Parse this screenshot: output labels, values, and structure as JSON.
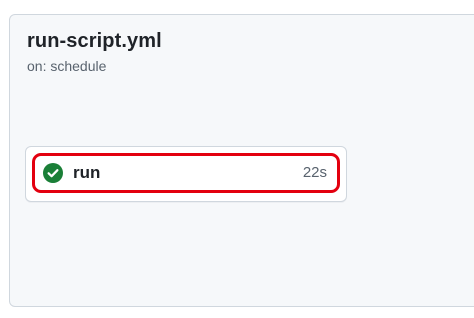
{
  "workflow": {
    "title": "run-script.yml",
    "trigger": "on: schedule"
  },
  "job": {
    "name": "run",
    "duration": "22s",
    "status": "success",
    "status_icon": "check-circle-icon",
    "status_color": "#1a7f37",
    "highlight_color": "#e3000f"
  }
}
